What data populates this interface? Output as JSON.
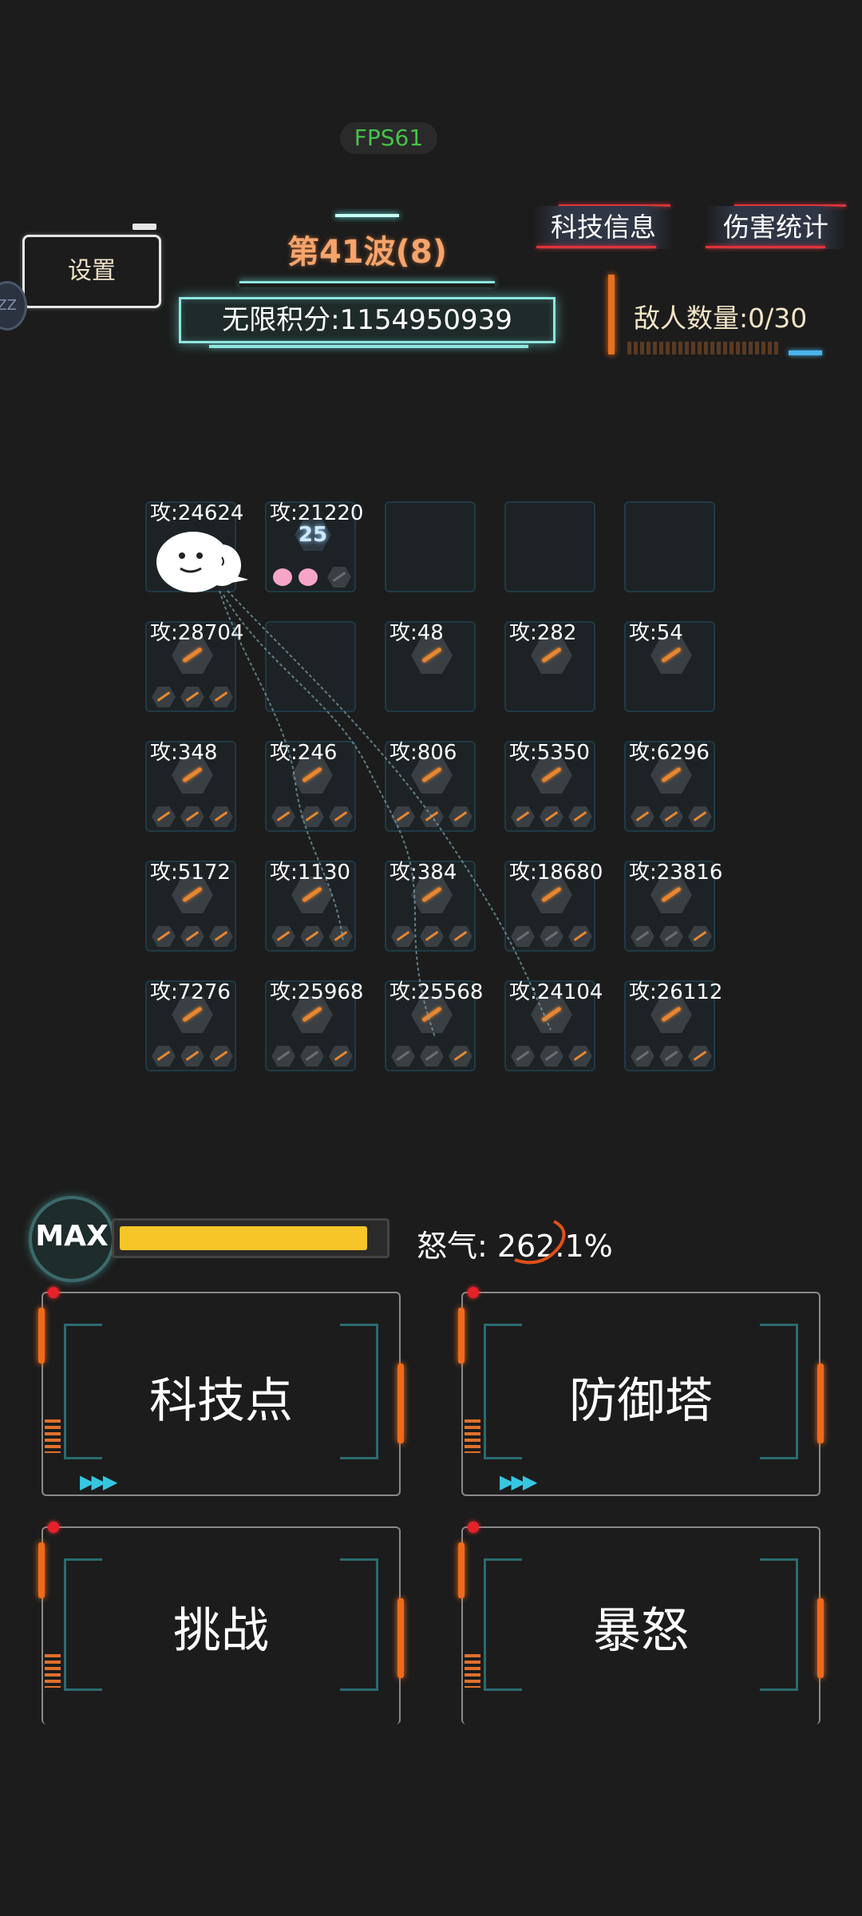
{
  "fps": "FPS61",
  "settings": "设置",
  "wave": "第41波(8)",
  "score": "无限积分:1154950939",
  "tech_info": "科技信息",
  "damage_stats": "伤害统计",
  "enemy_count": "敌人数量:0/30",
  "sleep_badge": "ZZ",
  "towers": [
    [
      "攻:24624",
      "攻:21220",
      "",
      "",
      ""
    ],
    [
      "攻:28704",
      "",
      "攻:48",
      "攻:282",
      "攻:54"
    ],
    [
      "攻:348",
      "攻:246",
      "攻:806",
      "攻:5350",
      "攻:6296"
    ],
    [
      "攻:5172",
      "攻:1130",
      "攻:384",
      "攻:18680",
      "攻:23816"
    ],
    [
      "攻:7276",
      "攻:25968",
      "攻:25568",
      "攻:24104",
      "攻:26112"
    ]
  ],
  "tower_level_badge": "25",
  "rage": {
    "max_label": "MAX",
    "label": "怒气: 262.1%",
    "fill_fraction": 0.97,
    "fill_color": "#f6c527"
  },
  "panels": {
    "tech": "科技点",
    "defense": "防御塔",
    "challenge": "挑战",
    "fury": "暴怒"
  },
  "colors": {
    "accent_orange": "#f06a1a",
    "accent_cyan": "#8fe6df",
    "fps_green": "#46c24a"
  }
}
